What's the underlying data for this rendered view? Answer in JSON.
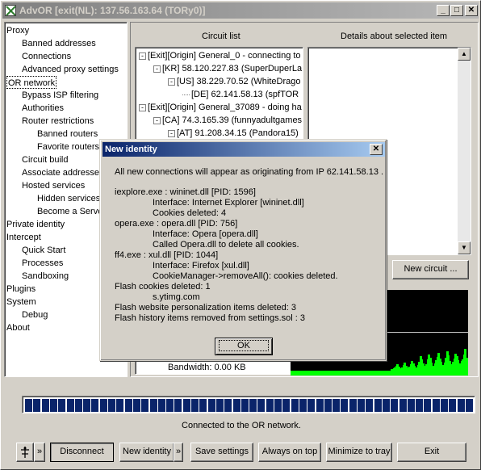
{
  "window": {
    "title": "AdvOR [exit(NL): 137.56.163.64 (TORy0)]",
    "min": "_",
    "max": "□",
    "close": "✕"
  },
  "sidebar": {
    "items": [
      {
        "label": "Proxy",
        "level": 0
      },
      {
        "label": "Banned addresses",
        "level": 1
      },
      {
        "label": "Connections",
        "level": 1
      },
      {
        "label": "Advanced proxy settings",
        "level": 1
      },
      {
        "label": "OR network",
        "level": 0,
        "selected": true
      },
      {
        "label": "Bypass ISP filtering",
        "level": 1
      },
      {
        "label": "Authorities",
        "level": 1
      },
      {
        "label": "Router restrictions",
        "level": 1
      },
      {
        "label": "Banned routers",
        "level": 2
      },
      {
        "label": "Favorite routers",
        "level": 2
      },
      {
        "label": "Circuit build",
        "level": 1
      },
      {
        "label": "Associate addresses",
        "level": 1
      },
      {
        "label": "Hosted services",
        "level": 1
      },
      {
        "label": "Hidden services",
        "level": 2
      },
      {
        "label": "Become a Server",
        "level": 2
      },
      {
        "label": "Private identity",
        "level": 0
      },
      {
        "label": "Intercept",
        "level": 0
      },
      {
        "label": "Quick Start",
        "level": 1
      },
      {
        "label": "Processes",
        "level": 1
      },
      {
        "label": "Sandboxing",
        "level": 1
      },
      {
        "label": "Plugins",
        "level": 0
      },
      {
        "label": "System",
        "level": 0
      },
      {
        "label": "Debug",
        "level": 1
      },
      {
        "label": "About",
        "level": 0
      }
    ]
  },
  "circuits": {
    "header": "Circuit list",
    "rows": [
      {
        "text": "[Exit][Origin] General_0 - connecting to",
        "indent": 0,
        "glyph": "-"
      },
      {
        "text": "[KR] 58.120.227.83 (SuperDuperLa",
        "indent": 1,
        "glyph": "-"
      },
      {
        "text": "[US] 38.229.70.52 (WhiteDrago",
        "indent": 2,
        "glyph": "-"
      },
      {
        "text": "[DE] 62.141.58.13 (spfTOR",
        "indent": 3,
        "glyph": ""
      },
      {
        "text": "[Exit][Origin] General_37089 - doing ha",
        "indent": 0,
        "glyph": "-"
      },
      {
        "text": "[CA] 74.3.165.39 (funnyadultgames",
        "indent": 1,
        "glyph": "-"
      },
      {
        "text": "[AT] 91.208.34.15 (Pandora15)",
        "indent": 2,
        "glyph": "-"
      }
    ],
    "partial_bottom": "Bandwidth: 0.00 KB"
  },
  "details": {
    "header": "Details about selected item"
  },
  "buttons": {
    "new_circuit": "New circuit ..."
  },
  "status": {
    "text": "Connected to the OR network.",
    "progress_segments": 54
  },
  "toolbar": {
    "more1": "»",
    "disconnect": "Disconnect",
    "new_identity": "New identity",
    "more2": "»",
    "save_settings": "Save settings",
    "always_on_top": "Always on top",
    "minimize_tray": "Minimize to tray",
    "exit": "Exit"
  },
  "dialog": {
    "title": "New identity",
    "close": "✕",
    "lines": [
      {
        "text": "All new connections will appear as originating from IP 62.141.58.13 .",
        "indent": 0
      },
      {
        "text": "",
        "indent": 0
      },
      {
        "text": "iexplore.exe : wininet.dll [PID: 1596]",
        "indent": 0
      },
      {
        "text": "Interface: Internet Explorer [wininet.dll]",
        "indent": 1
      },
      {
        "text": "Cookies deleted: 4",
        "indent": 1
      },
      {
        "text": "opera.exe : opera.dll [PID: 756]",
        "indent": 0
      },
      {
        "text": "Interface: Opera [opera.dll]",
        "indent": 1
      },
      {
        "text": "Called Opera.dll to delete all cookies.",
        "indent": 1
      },
      {
        "text": "ff4.exe : xul.dll [PID: 1044]",
        "indent": 0
      },
      {
        "text": "Interface: Firefox [xul.dll]",
        "indent": 1
      },
      {
        "text": "CookieManager->removeAll(): cookies deleted.",
        "indent": 1
      },
      {
        "text": "Flash cookies deleted: 1",
        "indent": 0
      },
      {
        "text": "s.ytimg.com",
        "indent": 1
      },
      {
        "text": "Flash website personalization items deleted: 3",
        "indent": 0
      },
      {
        "text": "Flash history items removed from settings.sol : 3",
        "indent": 0
      }
    ],
    "ok": "OK"
  },
  "colors": {
    "title_active": "#0a246a",
    "title_inactive": "#808080",
    "progress": "#0a246a",
    "graph_bg": "#000000",
    "graph_bars": "#00ff00"
  }
}
